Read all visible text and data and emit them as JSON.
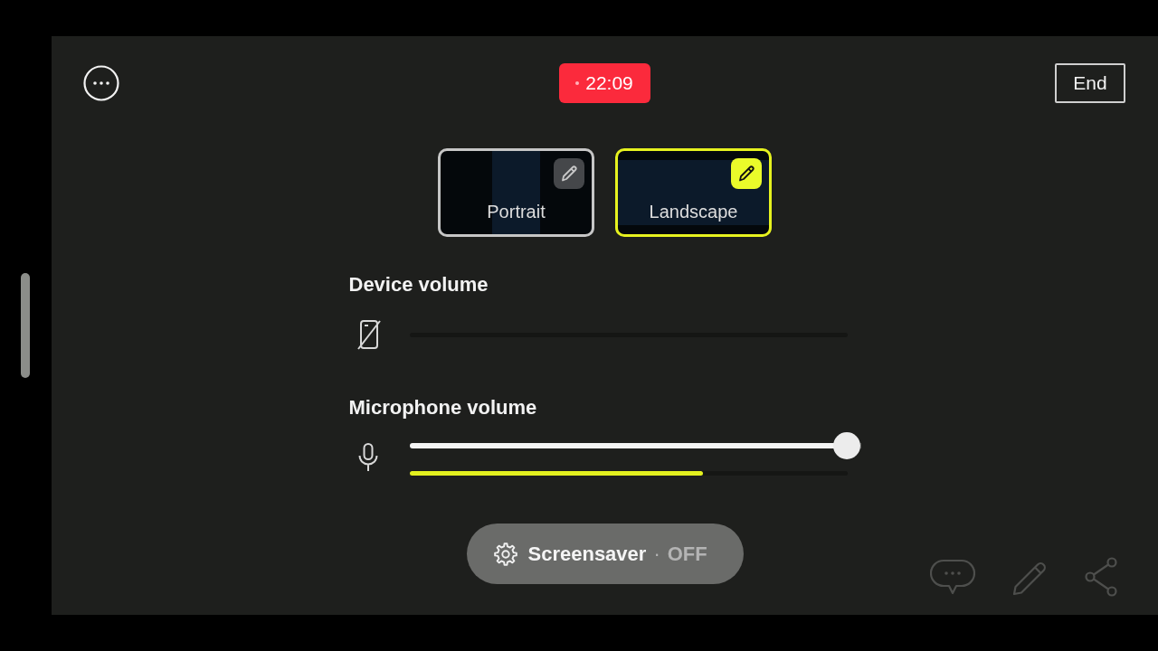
{
  "timer": {
    "time": "22:09"
  },
  "end_button": {
    "label": "End"
  },
  "layouts": [
    {
      "kind": "portrait",
      "label": "Portrait",
      "selected": false
    },
    {
      "kind": "landscape",
      "label": "Landscape",
      "selected": true
    }
  ],
  "volumes": [
    {
      "kind": "device",
      "label": "Device volume",
      "muted": true
    },
    {
      "kind": "microphone",
      "label": "Microphone volume",
      "muted": false,
      "slider": {
        "level": 1
      },
      "meter": {
        "level": 0.67
      }
    }
  ],
  "screensaver": {
    "label": "Screensaver",
    "separator": "·",
    "status": "OFF"
  }
}
